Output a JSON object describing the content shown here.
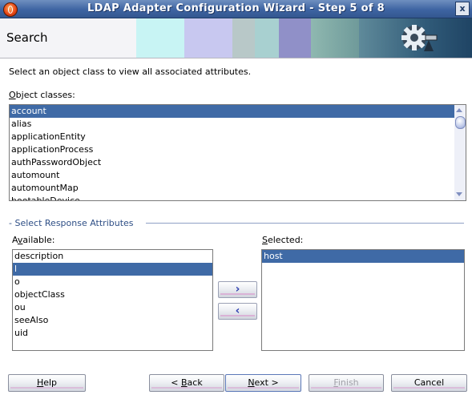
{
  "window": {
    "title": "LDAP Adapter Configuration Wizard - Step 5 of 8",
    "close_glyph": "x"
  },
  "header": {
    "title": "Search"
  },
  "instruction": "Select an object class to view all associated attributes.",
  "object_classes": {
    "label_mnemonic": "O",
    "label_rest": "bject classes:",
    "items": [
      "account",
      "alias",
      "applicationEntity",
      "applicationProcess",
      "authPasswordObject",
      "automount",
      "automountMap",
      "bootableDevice"
    ],
    "selected": "account"
  },
  "response_attributes": {
    "section_title": "- Select Response Attributes",
    "available_label_a": "A",
    "available_label_mnemonic": "v",
    "available_label_rest": "ailable:",
    "available_items": [
      "description",
      "l",
      "o",
      "objectClass",
      "ou",
      "seeAlso",
      "uid"
    ],
    "available_selected": "l",
    "selected_label_pre": "",
    "selected_label_mnemonic": "S",
    "selected_label_rest": "elected:",
    "selected_items": [
      "host"
    ],
    "move_right_glyph": "›",
    "move_left_glyph": "‹"
  },
  "buttons": {
    "help_mn": "H",
    "help_rest": "elp",
    "back_pre": "< ",
    "back_mn": "B",
    "back_rest": "ack",
    "next_mn": "N",
    "next_rest": "ext >",
    "finish_mn": "F",
    "finish_rest": "inish",
    "cancel": "Cancel"
  },
  "colors": {
    "selection": "#3f6aa6",
    "titlebar": "#3e64a2",
    "section_text": "#2f4f86"
  },
  "icons": [
    "app-logo-icon",
    "close-icon",
    "gear-plug-icon",
    "scroll-up-icon",
    "scroll-down-icon",
    "move-right-icon",
    "move-left-icon"
  ]
}
